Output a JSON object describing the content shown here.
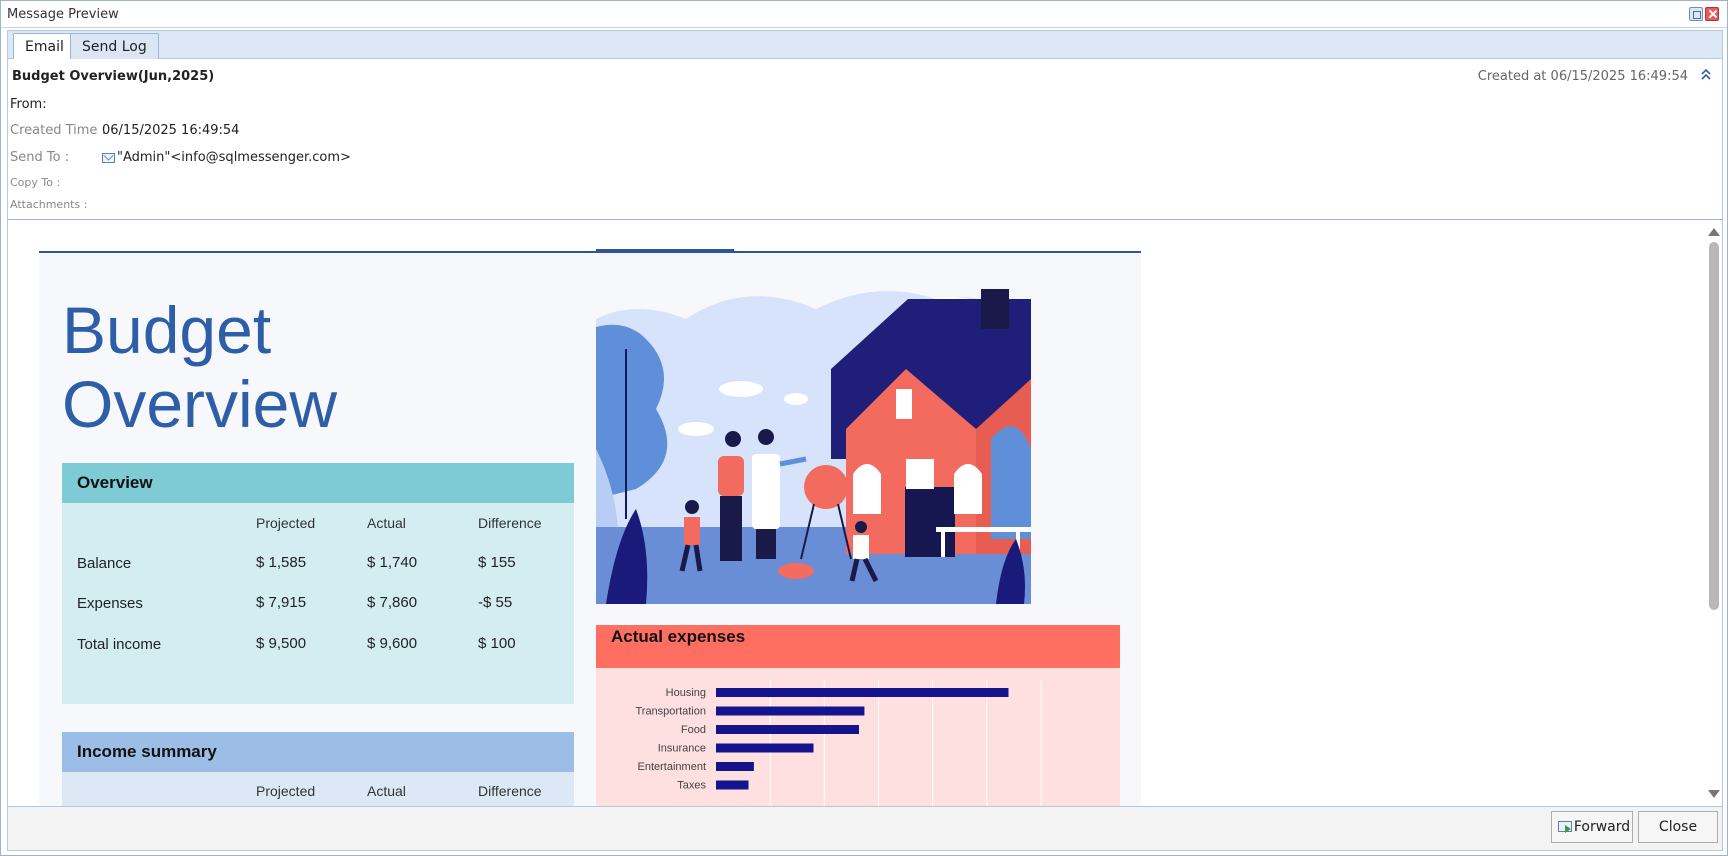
{
  "window": {
    "title": "Message Preview"
  },
  "tabs": [
    {
      "label": "Email"
    },
    {
      "label": "Send Log"
    }
  ],
  "header": {
    "subject": "Budget Overview(Jun,2025)",
    "created_at_label": "Created at",
    "created_at_value": "06/15/2025 16:49:54",
    "from_label": "From:",
    "created_time_label": "Created Time :",
    "created_time_value": "06/15/2025 16:49:54",
    "send_to_label": "Send To :",
    "send_to_value": "\"Admin\"<info@sqlmessenger.com>",
    "copy_to_label": "Copy To :",
    "attachments_label": "Attachments :"
  },
  "document": {
    "title_line1": "Budget",
    "title_line2": "Overview",
    "overview": {
      "heading": "Overview",
      "columns": [
        "Projected",
        "Actual",
        "Difference"
      ],
      "rows": [
        {
          "label": "Balance",
          "values": [
            "$ 1,585",
            "$ 1,740",
            "$ 155"
          ]
        },
        {
          "label": "Expenses",
          "values": [
            "$ 7,915",
            "$ 7,860",
            "-$ 55"
          ]
        },
        {
          "label": "Total income",
          "values": [
            "$ 9,500",
            "$ 9,600",
            "$ 100"
          ]
        }
      ]
    },
    "income_summary": {
      "heading": "Income summary",
      "columns": [
        "Projected",
        "Actual",
        "Difference"
      ]
    },
    "actual_expenses": {
      "heading": "Actual expenses"
    }
  },
  "chart_data": {
    "type": "bar",
    "orientation": "horizontal",
    "categories": [
      "Housing",
      "Transportation",
      "Food",
      "Insurance",
      "Entertainment",
      "Taxes"
    ],
    "values": [
      2700,
      1370,
      1320,
      900,
      350,
      300
    ],
    "xlim": [
      0,
      3000
    ],
    "grid": true,
    "bar_color": "#14148c"
  },
  "footer": {
    "forward_label": "Forward",
    "close_label": "Close"
  }
}
